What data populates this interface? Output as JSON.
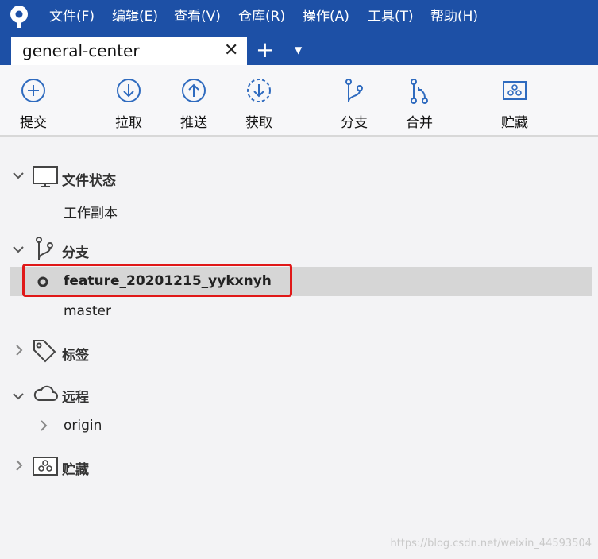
{
  "menu": [
    "文件(F)",
    "编辑(E)",
    "查看(V)",
    "仓库(R)",
    "操作(A)",
    "工具(T)",
    "帮助(H)"
  ],
  "tab": {
    "title": "general-center",
    "close": "✕",
    "add": "+",
    "dropdown": "▼"
  },
  "toolbar": {
    "commit": "提交",
    "pull": "拉取",
    "push": "推送",
    "fetch": "获取",
    "branch": "分支",
    "merge": "合并",
    "stash": "贮藏"
  },
  "sidebar": {
    "file_status": {
      "label": "文件状态",
      "items": [
        "工作副本"
      ]
    },
    "branches": {
      "label": "分支",
      "items": [
        "feature_20201215_yykxnyh",
        "master"
      ],
      "current": "feature_20201215_yykxnyh"
    },
    "tags": {
      "label": "标签"
    },
    "remotes": {
      "label": "远程",
      "items": [
        "origin"
      ]
    },
    "stashes": {
      "label": "贮藏"
    }
  },
  "watermark": "https://blog.csdn.net/weixin_44593504",
  "colors": {
    "titlebar": "#1d50a6",
    "accent": "#2f6bbf",
    "highlight": "#e01818"
  }
}
